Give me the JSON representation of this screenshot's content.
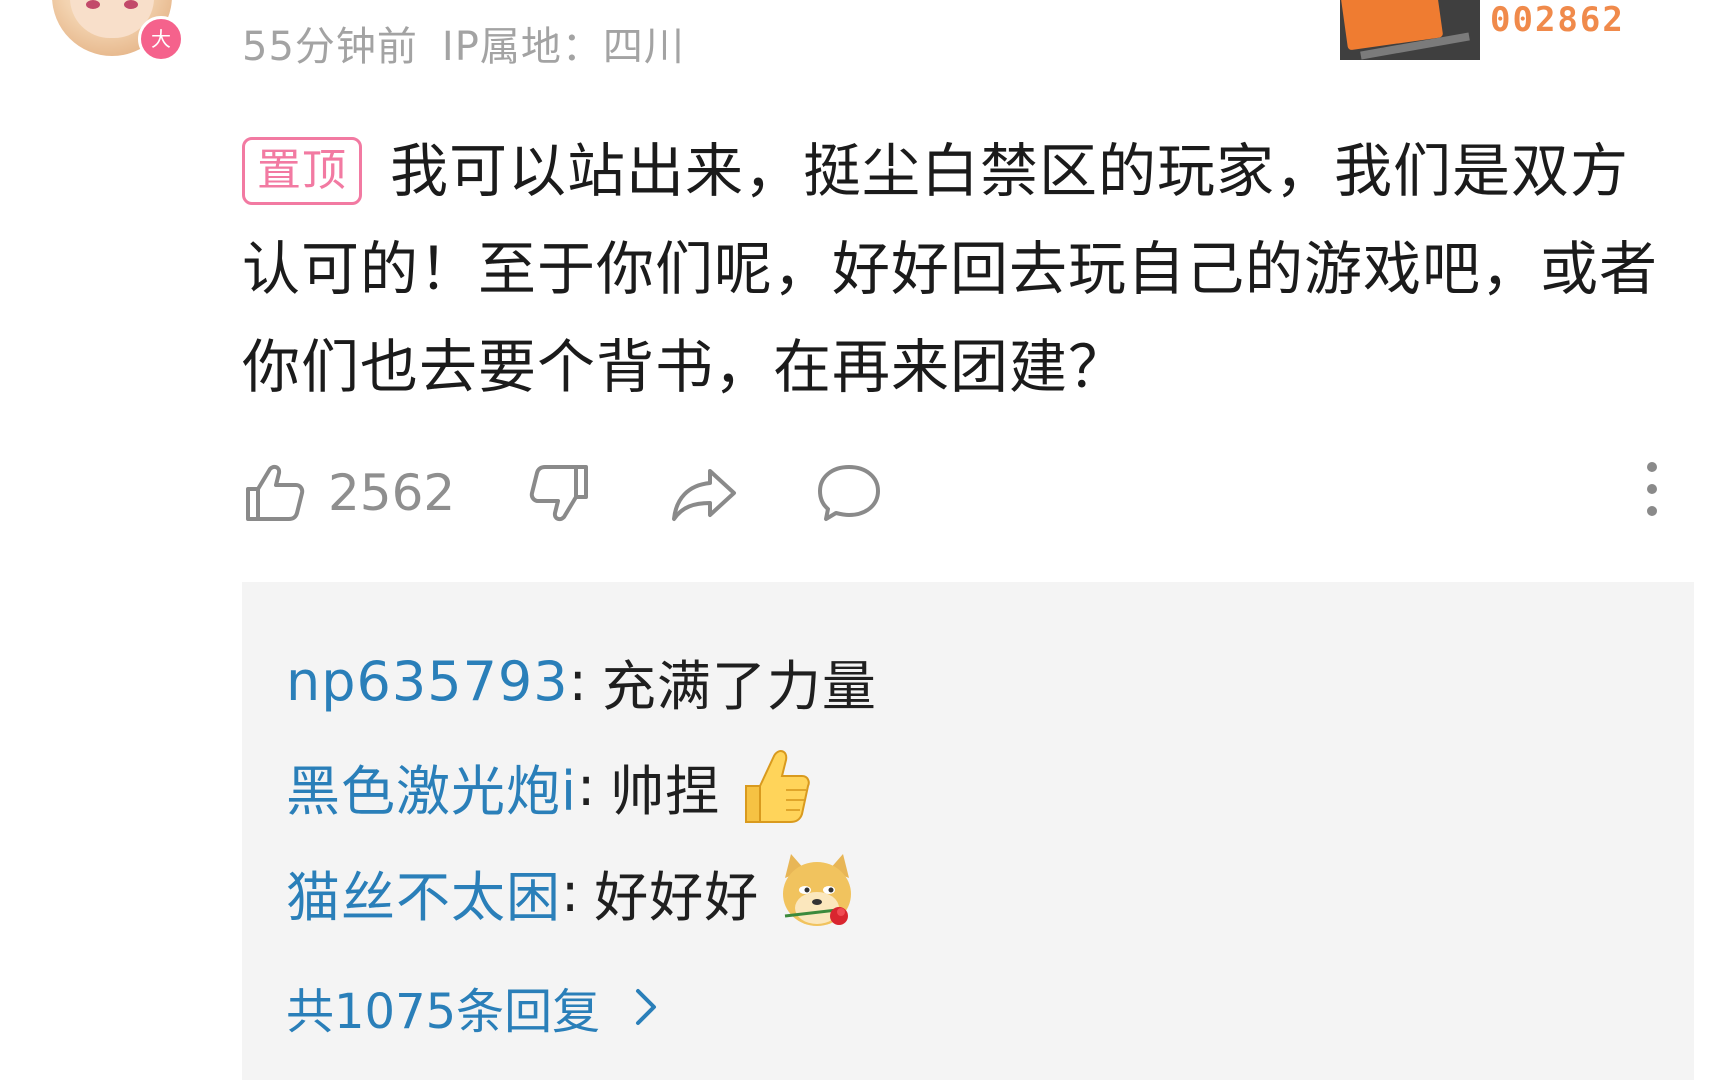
{
  "comment": {
    "level_badge": "大",
    "time": "55分钟前",
    "ip_location": "IP属地：四川",
    "fan_number": "002862",
    "pin_tag": "置顶",
    "text": "我可以站出来，挺尘白禁区的玩家，我们是双方认可的！至于你们呢，好好回去玩自己的游戏吧，或者你们也去要个背书，在再来团建？",
    "like_count": "2562",
    "icons": [
      "thumbs-up-icon",
      "thumbs-down-icon",
      "share-icon",
      "reply-bubble-icon",
      "more-vertical-icon"
    ]
  },
  "replies": {
    "items": [
      {
        "user": "np635793",
        "separator": ":",
        "text": "充满了力量",
        "emoji": ""
      },
      {
        "user": "黑色激光炮i",
        "separator": ":",
        "text": "帅捏",
        "emoji": "thumbs-up-emoji"
      },
      {
        "user": "猫丝不太困",
        "separator": ":",
        "text": "好好好",
        "emoji": "doge-rose-emoji"
      }
    ],
    "total_label": "共1075条回复"
  },
  "colors": {
    "accent_blue": "#2a7fb9",
    "pin_pink": "#f27aa2",
    "meta_gray": "#a3a3a3",
    "reply_bg": "#f4f4f4",
    "fan_orange": "#f08a4b"
  }
}
